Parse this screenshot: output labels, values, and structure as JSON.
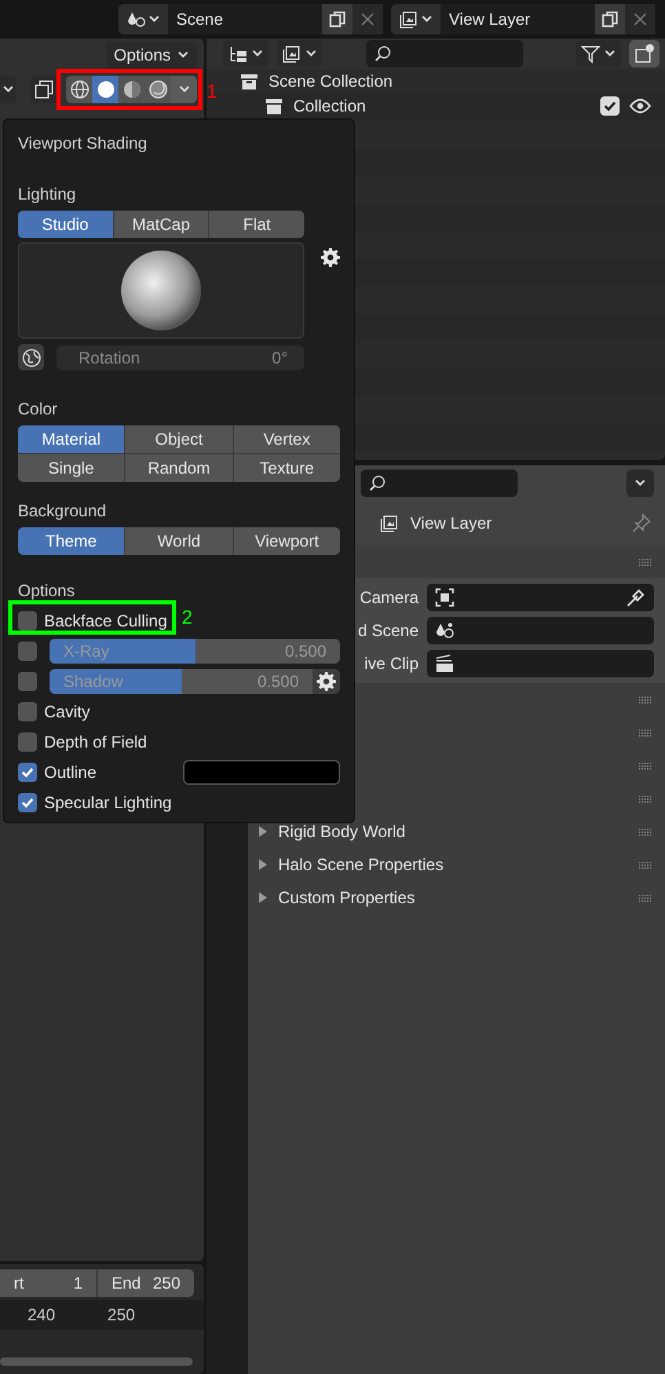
{
  "top_bar": {
    "scene": {
      "value": "Scene"
    },
    "view_layer": {
      "value": "View Layer"
    }
  },
  "viewport": {
    "options_button": "Options",
    "shading_modes": [
      {
        "kind": "wireframe",
        "selected": false
      },
      {
        "kind": "solid",
        "selected": true
      },
      {
        "kind": "material",
        "selected": false
      },
      {
        "kind": "rendered",
        "selected": false
      }
    ]
  },
  "timeline": {
    "start_label": "rt",
    "start_value": "1",
    "end_label": "End",
    "end_value": "250",
    "ruler": [
      "240",
      "250"
    ]
  },
  "outliner": {
    "items": [
      {
        "label": "Scene Collection",
        "children": [
          {
            "label": "Collection",
            "checked": true,
            "visible": true
          }
        ]
      }
    ]
  },
  "properties": {
    "title": "View Layer",
    "fields": [
      {
        "label": "Camera",
        "kind": "camera",
        "eyedropper": true
      },
      {
        "label": "d Scene",
        "kind": "scene",
        "eyedropper": false
      },
      {
        "label": "ive Clip",
        "kind": "clip",
        "eyedropper": false
      }
    ],
    "panels": [
      {
        "label": "Rigid Body World",
        "expanded": false
      },
      {
        "label": "Halo Scene Properties",
        "expanded": false
      },
      {
        "label": "Custom Properties",
        "expanded": false
      }
    ]
  },
  "shading_popover": {
    "title": "Viewport Shading",
    "lighting": {
      "heading": "Lighting",
      "modes": [
        {
          "label": "Studio",
          "selected": true
        },
        {
          "label": "MatCap",
          "selected": false
        },
        {
          "label": "Flat",
          "selected": false
        }
      ],
      "rotation": {
        "label": "Rotation",
        "value": "0°",
        "disabled": true
      }
    },
    "color": {
      "heading": "Color",
      "modes": [
        {
          "label": "Material",
          "selected": true
        },
        {
          "label": "Object",
          "selected": false
        },
        {
          "label": "Vertex",
          "selected": false
        },
        {
          "label": "Single",
          "selected": false
        },
        {
          "label": "Random",
          "selected": false
        },
        {
          "label": "Texture",
          "selected": false
        }
      ]
    },
    "background": {
      "heading": "Background",
      "modes": [
        {
          "label": "Theme",
          "selected": true
        },
        {
          "label": "World",
          "selected": false
        },
        {
          "label": "Viewport",
          "selected": false
        }
      ]
    },
    "options": {
      "heading": "Options",
      "items": [
        {
          "kind": "checkbox",
          "label": "Backface Culling",
          "checked": false
        },
        {
          "kind": "slider",
          "label": "X-Ray",
          "checked": false,
          "level": 0.5,
          "value": "0.500",
          "settings": false
        },
        {
          "kind": "slider",
          "label": "Shadow",
          "checked": false,
          "level": 0.5,
          "value": "0.500",
          "settings": true
        },
        {
          "kind": "checkbox",
          "label": "Cavity",
          "checked": false
        },
        {
          "kind": "checkbox",
          "label": "Depth of Field",
          "checked": false
        },
        {
          "kind": "color",
          "label": "Outline",
          "checked": true,
          "color": "#000000"
        },
        {
          "kind": "checkbox",
          "label": "Specular Lighting",
          "checked": true
        }
      ]
    }
  },
  "annotations": [
    {
      "label": "1",
      "color": "#ff0000"
    },
    {
      "label": "2",
      "color": "#00ff00"
    }
  ]
}
